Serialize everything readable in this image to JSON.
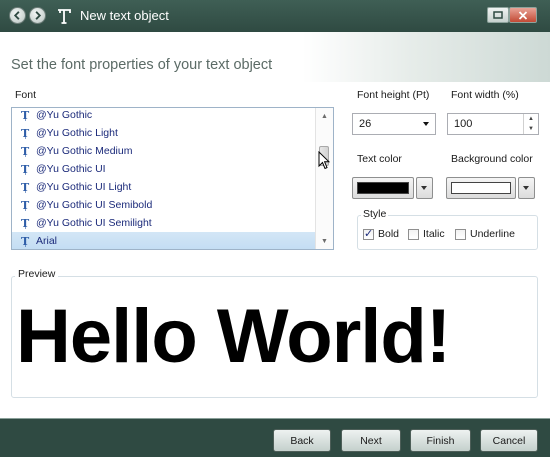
{
  "window": {
    "title": "New text object"
  },
  "subtitle": "Set the font properties of your text object",
  "font_section": {
    "label": "Font",
    "items": [
      {
        "name": "@Yu Gothic",
        "selected": false
      },
      {
        "name": "@Yu Gothic Light",
        "selected": false
      },
      {
        "name": "@Yu Gothic Medium",
        "selected": false
      },
      {
        "name": "@Yu Gothic UI",
        "selected": false
      },
      {
        "name": "@Yu Gothic UI Light",
        "selected": false
      },
      {
        "name": "@Yu Gothic UI Semibold",
        "selected": false
      },
      {
        "name": "@Yu Gothic UI Semilight",
        "selected": false
      },
      {
        "name": "Arial",
        "selected": true
      }
    ]
  },
  "font_height": {
    "label": "Font height (Pt)",
    "value": "26"
  },
  "font_width": {
    "label": "Font width (%)",
    "value": "100"
  },
  "text_color": {
    "label": "Text color",
    "color": "#000000"
  },
  "background_color": {
    "label": "Background color",
    "color": "#ffffff"
  },
  "style": {
    "label": "Style",
    "bold": {
      "label": "Bold",
      "checked": true
    },
    "italic": {
      "label": "Italic",
      "checked": false
    },
    "underline": {
      "label": "Underline",
      "checked": false
    }
  },
  "preview": {
    "label": "Preview",
    "text": "Hello World!"
  },
  "buttons": {
    "back": "Back",
    "next": "Next",
    "finish": "Finish",
    "cancel": "Cancel"
  },
  "colors": {
    "titlebar": "#2f4a42",
    "list_selection": "#c9e0f4",
    "list_text": "#1b2a7a"
  }
}
